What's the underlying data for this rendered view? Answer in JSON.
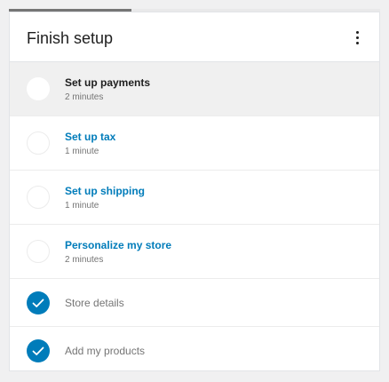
{
  "header": {
    "title": "Finish setup",
    "menu_icon": "more-vertical-icon"
  },
  "progress": {
    "fraction": 0.33
  },
  "colors": {
    "accent": "#007cba",
    "active_row": "#f0f0f0",
    "muted_text": "#757575"
  },
  "tasks": [
    {
      "title": "Set up payments",
      "time": "2 minutes",
      "status": "active"
    },
    {
      "title": "Set up tax",
      "time": "1 minute",
      "status": "todo"
    },
    {
      "title": "Set up shipping",
      "time": "1 minute",
      "status": "todo"
    },
    {
      "title": "Personalize my store",
      "time": "2 minutes",
      "status": "todo"
    },
    {
      "title": "Store details",
      "status": "done"
    },
    {
      "title": "Add my products",
      "status": "done"
    }
  ]
}
